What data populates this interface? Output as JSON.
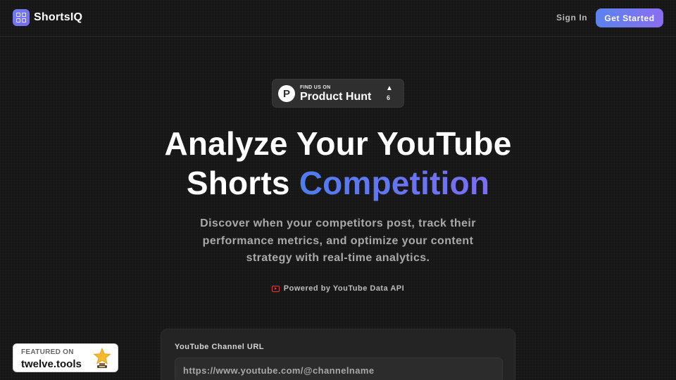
{
  "header": {
    "app_name": "ShortsIQ",
    "sign_in_label": "Sign In",
    "get_started_label": "Get Started"
  },
  "product_hunt": {
    "small_text": "FIND US ON",
    "big_text": "Product Hunt",
    "upvote_count": "6",
    "logo_letter": "P"
  },
  "hero": {
    "title_line1": "Analyze Your YouTube",
    "title_line2_plain": "Shorts ",
    "title_line2_accent": "Competition",
    "subtitle": "Discover when your competitors post, track their performance metrics, and optimize your content strategy with real-time analytics.",
    "powered_by": "Powered by YouTube Data API"
  },
  "form": {
    "channel_label": "YouTube Channel URL",
    "channel_placeholder": "https://www.youtube.com/@channelname"
  },
  "featured_badge": {
    "small_text": "FEATURED ON",
    "big_text": "twelve.tools"
  },
  "colors": {
    "background": "#161616",
    "accent_start": "#4f7cf0",
    "accent_end": "#7b6ef2",
    "youtube_red": "#e23b3b"
  },
  "icons": [
    "grid-logo-icon",
    "product-hunt-logo-icon",
    "upvote-arrow-icon",
    "youtube-play-icon",
    "trophy-star-icon"
  ]
}
